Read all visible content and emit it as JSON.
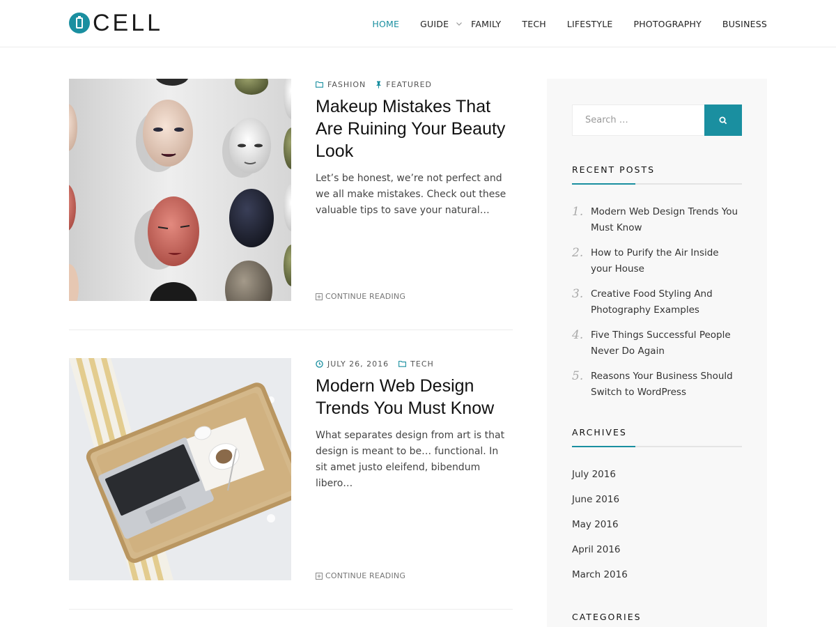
{
  "header": {
    "logo_text": "CELL",
    "nav": [
      {
        "label": "HOME",
        "active": true
      },
      {
        "label": "GUIDE",
        "has_submenu": true
      },
      {
        "label": "FAMILY"
      },
      {
        "label": "TECH"
      },
      {
        "label": "LIFESTYLE"
      },
      {
        "label": "PHOTOGRAPHY"
      },
      {
        "label": "BUSINESS"
      }
    ]
  },
  "posts": [
    {
      "meta": [
        {
          "icon": "folder-icon",
          "text": "FASHION"
        },
        {
          "icon": "pin-icon",
          "text": "FEATURED"
        }
      ],
      "title": "Makeup Mistakes That Are Ruining Your Beauty Look",
      "excerpt": "Let’s be honest, we’re not perfect and we all make mistakes. Check out these valuable tips to save your natural…",
      "continue_label": "CONTINUE READING",
      "image": "mannequin-faces-on-wall"
    },
    {
      "meta": [
        {
          "icon": "clock-icon",
          "text": "JULY 26, 2016"
        },
        {
          "icon": "folder-icon",
          "text": "TECH"
        }
      ],
      "title": "Modern Web Design Trends You Must Know",
      "excerpt": "What separates design from art is that design is meant to be… functional. In sit amet justo eleifend, bibendum libero…",
      "continue_label": "CONTINUE READING",
      "image": "laptop-on-tray"
    }
  ],
  "sidebar": {
    "search": {
      "placeholder": "Search …",
      "value": ""
    },
    "recent_posts": {
      "title": "RECENT POSTS",
      "items": [
        {
          "num": "1.",
          "label": "Modern Web Design Trends You Must Know"
        },
        {
          "num": "2.",
          "label": "How to Purify the Air Inside your House"
        },
        {
          "num": "3.",
          "label": "Creative Food Styling And Photography Examples"
        },
        {
          "num": "4.",
          "label": "Five Things Successful People Never Do Again"
        },
        {
          "num": "5.",
          "label": "Reasons Your Business Should Switch to WordPress"
        }
      ]
    },
    "archives": {
      "title": "ARCHIVES",
      "items": [
        "July 2016",
        "June 2016",
        "May 2016",
        "April 2016",
        "March 2016"
      ]
    },
    "categories": {
      "title": "CATEGORIES"
    }
  },
  "colors": {
    "accent": "#1a8fa0",
    "sidebar_bg": "#f8f8f8",
    "text": "#333333"
  }
}
